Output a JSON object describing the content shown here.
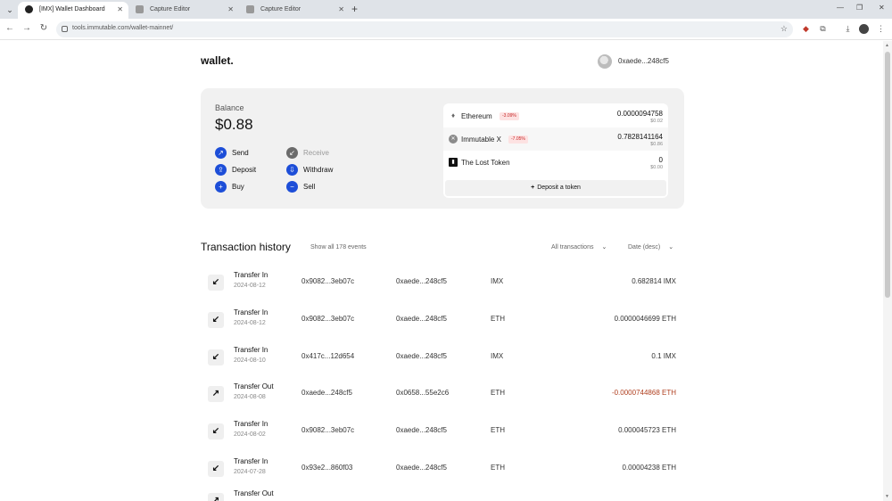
{
  "browser": {
    "tabs": [
      {
        "title": "[IMX] Wallet Dashboard",
        "active": true
      },
      {
        "title": "Capture Editor",
        "active": false
      },
      {
        "title": "Capture Editor",
        "active": false
      }
    ],
    "url": "tools.immutable.com/wallet-mainnet/"
  },
  "header": {
    "logo": "wallet.",
    "account_address": "0xaede...248cf5"
  },
  "balance": {
    "label": "Balance",
    "value": "$0.88",
    "actions": [
      {
        "label": "Send",
        "icon": "arrow-up-right-icon",
        "enabled": true
      },
      {
        "label": "Receive",
        "icon": "arrow-down-left-icon",
        "enabled": false
      },
      {
        "label": "Deposit",
        "icon": "deposit-icon",
        "enabled": true
      },
      {
        "label": "Withdraw",
        "icon": "withdraw-icon",
        "enabled": true
      },
      {
        "label": "Buy",
        "icon": "plus-icon",
        "enabled": true
      },
      {
        "label": "Sell",
        "icon": "minus-icon",
        "enabled": true
      }
    ]
  },
  "tokens": {
    "items": [
      {
        "name": "Ethereum",
        "change": "-3.09%",
        "amount": "0.0000094758",
        "fiat": "$0.02",
        "icon": "ethereum-icon"
      },
      {
        "name": "Immutable X",
        "change": "-7.05%",
        "amount": "0.7828141164",
        "fiat": "$0.86",
        "icon": "immutable-x-icon"
      },
      {
        "name": "The Lost Token",
        "change": "",
        "amount": "0",
        "fiat": "$0.00",
        "icon": "lost-token-icon"
      }
    ],
    "deposit_label": "Deposit a token"
  },
  "transactions": {
    "title": "Transaction history",
    "show_all": "Show all 178 events",
    "filter_type": "All transactions",
    "sort": "Date (desc)",
    "rows": [
      {
        "type": "Transfer In",
        "date": "2024-08-12",
        "from": "0x9082...3eb07c",
        "to": "0xaede...248cf5",
        "token": "IMX",
        "value": "0.682814 IMX",
        "direction": "in"
      },
      {
        "type": "Transfer In",
        "date": "2024-08-12",
        "from": "0x9082...3eb07c",
        "to": "0xaede...248cf5",
        "token": "ETH",
        "value": "0.0000046699 ETH",
        "direction": "in"
      },
      {
        "type": "Transfer In",
        "date": "2024-08-10",
        "from": "0x417c...12d654",
        "to": "0xaede...248cf5",
        "token": "IMX",
        "value": "0.1 IMX",
        "direction": "in"
      },
      {
        "type": "Transfer Out",
        "date": "2024-08-08",
        "from": "0xaede...248cf5",
        "to": "0x0658...55e2c6",
        "token": "ETH",
        "value": "-0.0000744868 ETH",
        "direction": "out"
      },
      {
        "type": "Transfer In",
        "date": "2024-08-02",
        "from": "0x9082...3eb07c",
        "to": "0xaede...248cf5",
        "token": "ETH",
        "value": "0.000045723 ETH",
        "direction": "in"
      },
      {
        "type": "Transfer In",
        "date": "2024-07-28",
        "from": "0x93e2...860f03",
        "to": "0xaede...248cf5",
        "token": "ETH",
        "value": "0.00004238 ETH",
        "direction": "in"
      },
      {
        "type": "Transfer Out",
        "date": "",
        "from": "",
        "to": "",
        "token": "",
        "value": "",
        "direction": "out"
      }
    ]
  }
}
